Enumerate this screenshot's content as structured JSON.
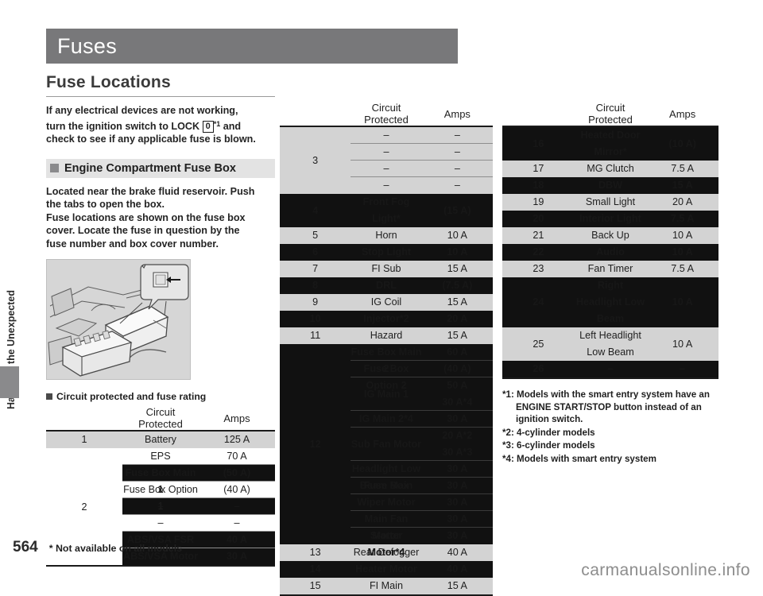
{
  "page": {
    "title": "Fuses",
    "page_number": "564",
    "footer_note": "* Not available on all models",
    "watermark": "carmanualsonline.info",
    "side_tab_label": "Handling the Unexpected"
  },
  "left": {
    "heading": "Fuse Locations",
    "intro_line1": "If any electrical devices are not working,",
    "intro_line2_pre": "turn the ignition switch to LOCK",
    "intro_key": "0",
    "intro_sup": "*1",
    "intro_line2_post": "and",
    "intro_line3": "check to see if any applicable fuse is blown.",
    "subhead": "Engine Compartment Fuse Box",
    "para2_line1": "Located near the brake fluid reservoir. Push",
    "para2_line2": "the tabs to open the box.",
    "para2_line3": "Fuse locations are shown on the fuse box",
    "para2_line4": "cover. Locate the fuse in question by the",
    "para2_line5": "fuse number and box cover number.",
    "mini_head": "Circuit protected and fuse rating"
  },
  "headers": {
    "num": "",
    "circuit": "Circuit Protected",
    "amps": "Amps"
  },
  "table_left": {
    "rows": [
      {
        "num": "1",
        "shade": "light",
        "name": "Battery",
        "amps": "125 A"
      },
      {
        "num": "2",
        "shade": "multi",
        "subs": [
          {
            "shade": "white",
            "name": "EPS",
            "amps": "70 A"
          },
          {
            "shade": "dark",
            "name": "Fuse Box Main 1",
            "amps": "(50 A)"
          },
          {
            "shade": "white",
            "name": "Fuse Box Option 1",
            "amps": "(40 A)"
          },
          {
            "shade": "dark",
            "name": "–",
            "amps": "–"
          },
          {
            "shade": "white",
            "name": "–",
            "amps": "–"
          },
          {
            "shade": "dark",
            "name": "ABS/VSA FSR",
            "amps": "40 A"
          },
          {
            "shade": "dark",
            "name": "ABS/VSA Motor",
            "amps": "30 A"
          }
        ]
      }
    ]
  },
  "table_mid": {
    "rows": [
      {
        "num": "3",
        "shade": "light",
        "multi": true,
        "subs": [
          {
            "name": "–",
            "amps": "–"
          },
          {
            "name": "–",
            "amps": "–"
          },
          {
            "name": "–",
            "amps": "–"
          },
          {
            "name": "–",
            "amps": "–"
          }
        ]
      },
      {
        "num": "4",
        "shade": "dark",
        "name": "Front Fog Light*",
        "amps": "(15 A)"
      },
      {
        "num": "5",
        "shade": "light",
        "name": "Horn",
        "amps": "10 A"
      },
      {
        "num": "6",
        "shade": "dark",
        "name": "Stop Light",
        "amps": "10 A"
      },
      {
        "num": "7",
        "shade": "light",
        "name": "FI Sub",
        "amps": "15 A"
      },
      {
        "num": "8",
        "shade": "dark",
        "name": "DRL",
        "amps": "(7.5 A)"
      },
      {
        "num": "9",
        "shade": "light",
        "name": "IG Coil",
        "amps": "15 A"
      },
      {
        "num": "10",
        "shade": "dark",
        "name": "Injector*2",
        "amps": "20 A"
      },
      {
        "num": "11",
        "shade": "light",
        "name": "Hazard",
        "amps": "15 A"
      },
      {
        "num": "12",
        "shade": "dark",
        "multi": true,
        "subs": [
          {
            "name": "Fuse Box Main 2",
            "amps": "60 A"
          },
          {
            "name": "Fuse Box Option 2",
            "amps": "(40 A)"
          },
          {
            "name": "IG Main 1",
            "amps": "50 A\n30 A*4"
          },
          {
            "name": "IG Main 2*4",
            "amps": "30 A"
          },
          {
            "name": "Sub Fan Motor",
            "amps": "20 A*2\n30 A*3"
          },
          {
            "name": "Headlight Low Beam Main",
            "amps": "30 A"
          },
          {
            "name": "Fuse Box",
            "amps": "30 A"
          },
          {
            "name": "Wiper Motor",
            "amps": "30 A"
          },
          {
            "name": "Main Fan Motor",
            "amps": "30 A"
          },
          {
            "name": "Starter Motor*4",
            "amps": "30 A"
          }
        ]
      },
      {
        "num": "13",
        "shade": "light",
        "name": "Rear Defogger",
        "amps": "40 A"
      },
      {
        "num": "14",
        "shade": "dark",
        "name": "Heater Motor",
        "amps": "40 A"
      },
      {
        "num": "15",
        "shade": "light",
        "name": "FI Main",
        "amps": "15 A"
      }
    ]
  },
  "table_right": {
    "rows": [
      {
        "num": "16",
        "shade": "dark",
        "name": "Heated Door Mirror*",
        "amps": "(10 A)"
      },
      {
        "num": "17",
        "shade": "light",
        "name": "MG Clutch",
        "amps": "7.5 A"
      },
      {
        "num": "18",
        "shade": "dark",
        "name": "DBW",
        "amps": "15 A"
      },
      {
        "num": "19",
        "shade": "light",
        "name": "Small Light",
        "amps": "20 A"
      },
      {
        "num": "20",
        "shade": "dark",
        "name": "Interior Light",
        "amps": "7.5 A"
      },
      {
        "num": "21",
        "shade": "light",
        "name": "Back Up",
        "amps": "10 A"
      },
      {
        "num": "22",
        "shade": "dark",
        "name": "Audio",
        "amps": "10 A"
      },
      {
        "num": "23",
        "shade": "light",
        "name": "Fan Timer",
        "amps": "7.5 A"
      },
      {
        "num": "24",
        "shade": "dark",
        "name": "Right Headlight Low Beam",
        "amps": "10 A"
      },
      {
        "num": "25",
        "shade": "light",
        "name": "Left Headlight Low Beam",
        "amps": "10 A"
      },
      {
        "num": "26",
        "shade": "dark",
        "name": "–",
        "amps": "–"
      }
    ]
  },
  "footnotes": {
    "fn1_a": "*1: Models with the smart entry system have an",
    "fn1_b": "ENGINE START/STOP button instead of an",
    "fn1_c": "ignition switch.",
    "fn2": "*2: 4-cylinder models",
    "fn3": "*3: 6-cylinder models",
    "fn4": "*4: Models with smart entry system"
  }
}
